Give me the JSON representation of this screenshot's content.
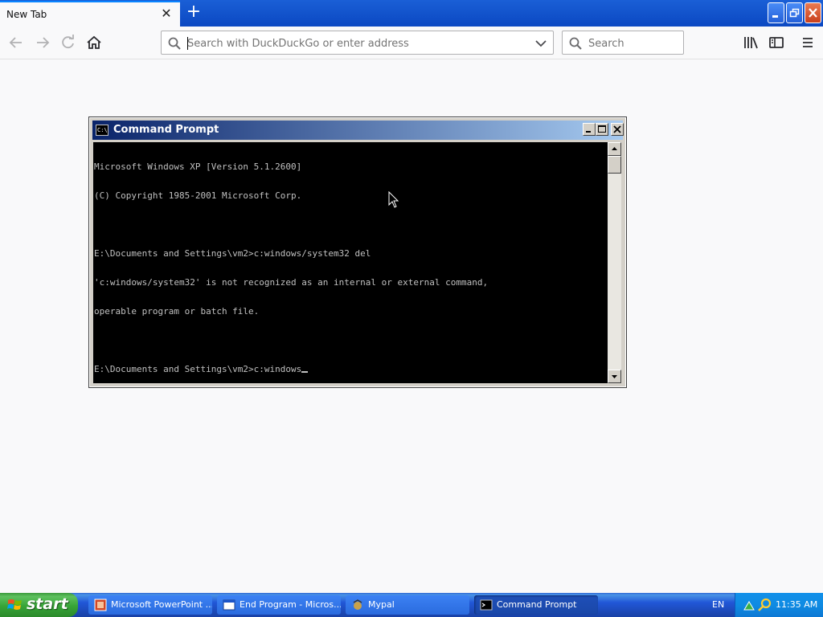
{
  "browser": {
    "tab": {
      "title": "New Tab"
    },
    "url_bar": {
      "placeholder": "Search with DuckDuckGo or enter address",
      "value": ""
    },
    "search_bar": {
      "placeholder": "Search"
    },
    "icons": [
      "back-icon",
      "forward-icon",
      "reload-icon",
      "home-icon",
      "library-icon",
      "sidebar-icon",
      "menu-icon",
      "search-icon",
      "dropdown-icon"
    ]
  },
  "cmd_window": {
    "title": "Command Prompt",
    "console_lines": [
      "Microsoft Windows XP [Version 5.1.2600]",
      "(C) Copyright 1985-2001 Microsoft Corp.",
      "",
      "E:\\Documents and Settings\\vm2>c:windows/system32 del",
      "'c:windows/system32' is not recognized as an internal or external command,",
      "operable program or batch file.",
      "",
      "E:\\Documents and Settings\\vm2>c:windows"
    ]
  },
  "taskbar": {
    "start_label": "start",
    "tasks": [
      {
        "label": "Microsoft PowerPoint ...",
        "icon": "powerpoint-icon"
      },
      {
        "label": "End Program - Micros...",
        "icon": "window-icon"
      },
      {
        "label": "Mypal",
        "icon": "mypal-icon"
      },
      {
        "label": "Command Prompt",
        "icon": "cmd-icon"
      }
    ],
    "language": "EN",
    "clock": "11:35 AM"
  },
  "colors": {
    "xp_blue": "#245edb",
    "start_green": "#3c9a3c",
    "console_bg": "#000000",
    "console_fg": "#c0c0c0",
    "tab_accent": "#0a84ff"
  }
}
